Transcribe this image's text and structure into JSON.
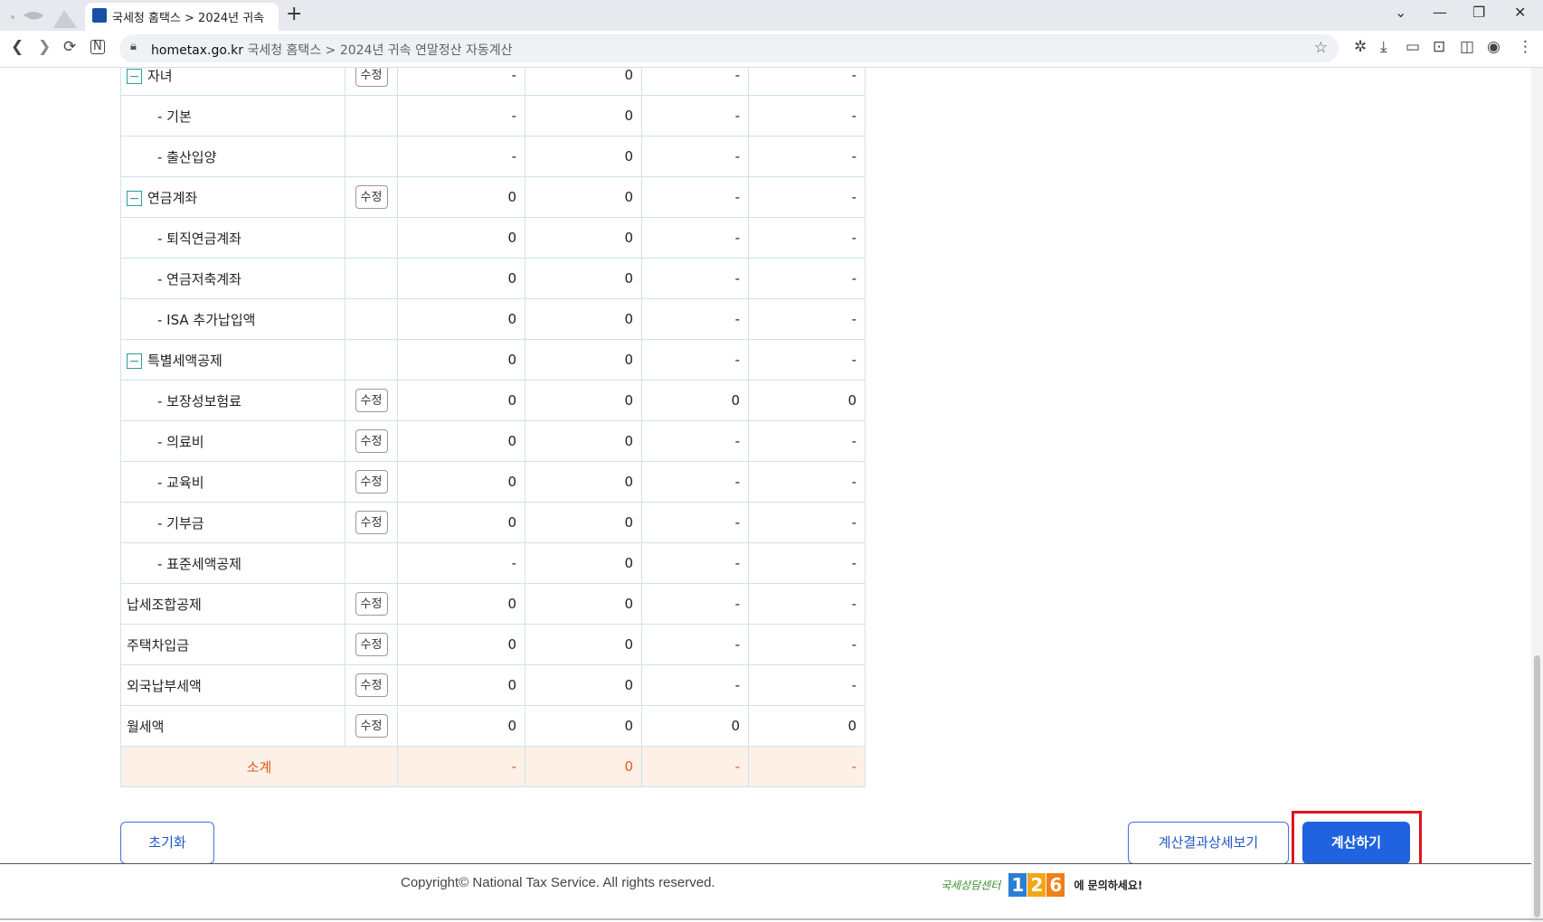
{
  "browser": {
    "tab_title": "국세청 홈택스 > 2024년 귀속",
    "new_tab": "+",
    "controls": {
      "dropdown": "⌄",
      "minimize": "—",
      "restore": "❐",
      "close": "✕"
    },
    "url_domain": "hometax.go.kr",
    "url_path": " 국세청 홈택스 > 2024년 귀속 연말정산 자동계산",
    "icons": [
      "back-icon",
      "forward-icon",
      "reload-icon",
      "notion-icon",
      "lock-icon",
      "star-icon",
      "extensions-icon",
      "download-icon",
      "camera-icon",
      "screenshot-icon",
      "sidebar-icon",
      "profile-icon",
      "menu-icon"
    ]
  },
  "table": {
    "edit_label": "수정",
    "toggle_symbol": "−",
    "rows": [
      {
        "label": "자녀",
        "toggle": true,
        "edit": true,
        "sub": false,
        "v": [
          "-",
          "0",
          "-",
          "-"
        ]
      },
      {
        "label": "- 기본",
        "toggle": false,
        "edit": false,
        "sub": true,
        "v": [
          "-",
          "0",
          "-",
          "-"
        ]
      },
      {
        "label": "- 출산입양",
        "toggle": false,
        "edit": false,
        "sub": true,
        "v": [
          "-",
          "0",
          "-",
          "-"
        ]
      },
      {
        "label": "연금계좌",
        "toggle": true,
        "edit": true,
        "sub": false,
        "v": [
          "0",
          "0",
          "-",
          "-"
        ]
      },
      {
        "label": "- 퇴직연금계좌",
        "toggle": false,
        "edit": false,
        "sub": true,
        "v": [
          "0",
          "0",
          "-",
          "-"
        ]
      },
      {
        "label": "- 연금저축계좌",
        "toggle": false,
        "edit": false,
        "sub": true,
        "v": [
          "0",
          "0",
          "-",
          "-"
        ]
      },
      {
        "label": "- ISA 추가납입액",
        "toggle": false,
        "edit": false,
        "sub": true,
        "v": [
          "0",
          "0",
          "-",
          "-"
        ]
      },
      {
        "label": "특별세액공제",
        "toggle": true,
        "edit": false,
        "sub": false,
        "v": [
          "0",
          "0",
          "-",
          "-"
        ]
      },
      {
        "label": "- 보장성보험료",
        "toggle": false,
        "edit": true,
        "sub": true,
        "v": [
          "0",
          "0",
          "0",
          "0"
        ]
      },
      {
        "label": "- 의료비",
        "toggle": false,
        "edit": true,
        "sub": true,
        "v": [
          "0",
          "0",
          "-",
          "-"
        ]
      },
      {
        "label": "- 교육비",
        "toggle": false,
        "edit": true,
        "sub": true,
        "v": [
          "0",
          "0",
          "-",
          "-"
        ]
      },
      {
        "label": "- 기부금",
        "toggle": false,
        "edit": true,
        "sub": true,
        "v": [
          "0",
          "0",
          "-",
          "-"
        ]
      },
      {
        "label": "- 표준세액공제",
        "toggle": false,
        "edit": false,
        "sub": true,
        "v": [
          "-",
          "0",
          "-",
          "-"
        ]
      },
      {
        "label": "납세조합공제",
        "toggle": false,
        "edit": true,
        "sub": false,
        "v": [
          "0",
          "0",
          "-",
          "-"
        ]
      },
      {
        "label": "주택차입금",
        "toggle": false,
        "edit": true,
        "sub": false,
        "v": [
          "0",
          "0",
          "-",
          "-"
        ]
      },
      {
        "label": "외국납부세액",
        "toggle": false,
        "edit": true,
        "sub": false,
        "v": [
          "0",
          "0",
          "-",
          "-"
        ]
      },
      {
        "label": "월세액",
        "toggle": false,
        "edit": true,
        "sub": false,
        "v": [
          "0",
          "0",
          "0",
          "0"
        ]
      }
    ],
    "subtotal": {
      "label": "소계",
      "v": [
        "-",
        "0",
        "-",
        "-"
      ]
    }
  },
  "buttons": {
    "reset": "초기화",
    "detail": "계산결과상세보기",
    "calculate": "계산하기"
  },
  "footer": {
    "copyright": "Copyright© National Tax Service. All rights reserved.",
    "consult_prefix": "국세상담센터",
    "consult_number": [
      "1",
      "2",
      "6"
    ],
    "consult_suffix": "에 문의하세요!"
  },
  "colors": {
    "primary": "#1f63e0",
    "subtotal_text": "#e05a1a",
    "subtotal_bg": "#fdf0e6",
    "highlight": "#e0141e"
  }
}
